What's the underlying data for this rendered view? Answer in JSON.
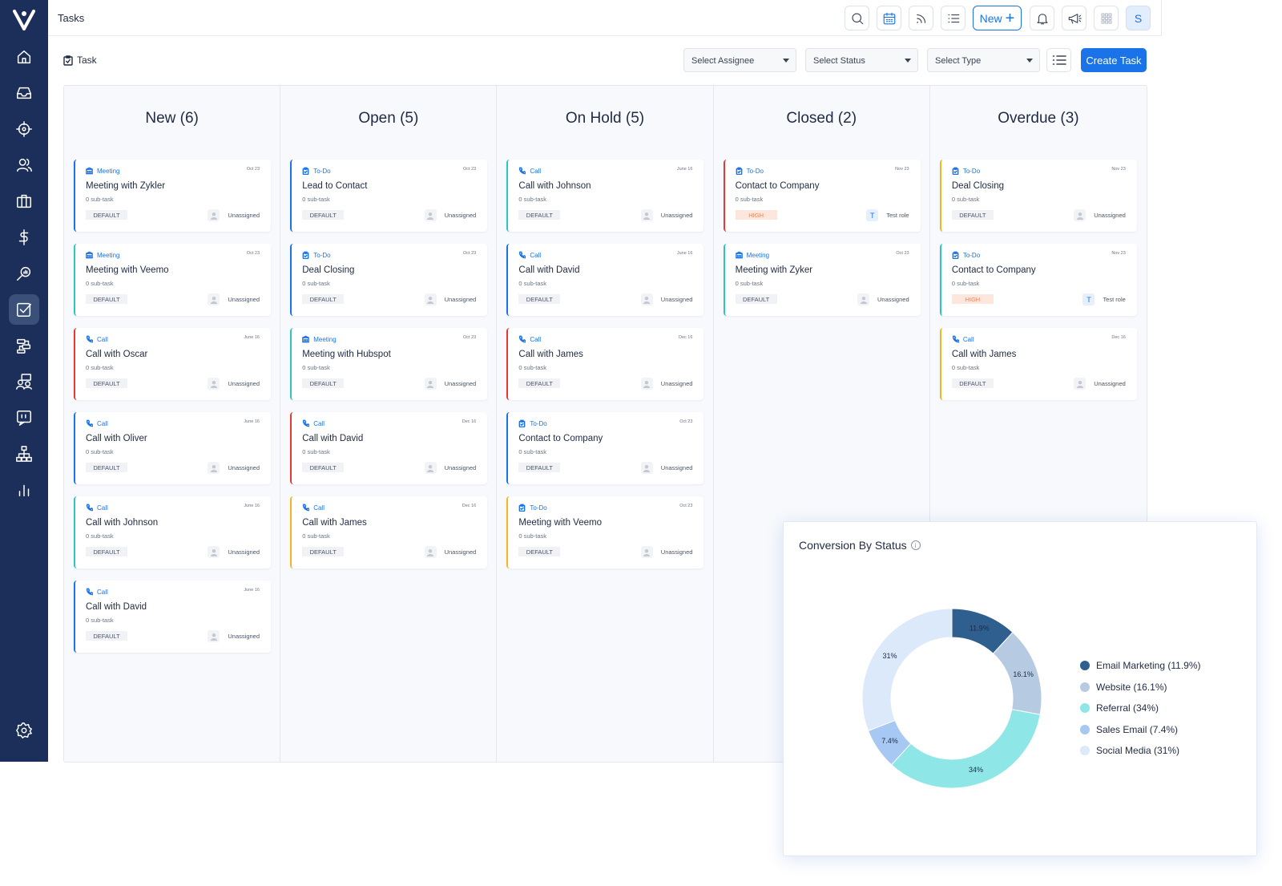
{
  "topbar": {
    "title": "Tasks",
    "new_label": "New",
    "avatar_initial": "S"
  },
  "filters": {
    "task_label": "Task",
    "assignee": "Select Assignee",
    "status": "Select Status",
    "type": "Select Type",
    "create_label": "Create Task"
  },
  "columns": [
    {
      "title": "New (6)",
      "cards": [
        {
          "type": "Meeting",
          "date": "Oct 23",
          "name": "Meeting with Zykler",
          "sub": "0 sub-task",
          "tag": "DEFAULT",
          "assignee": "Unassigned",
          "color": "#1a73e8"
        },
        {
          "type": "Meeting",
          "date": "Oct 23",
          "name": "Meeting with Veemo",
          "sub": "0 sub-task",
          "tag": "DEFAULT",
          "assignee": "Unassigned",
          "color": "#2ec4c4"
        },
        {
          "type": "Call",
          "date": "June 16",
          "name": "Call with Oscar",
          "sub": "0 sub-task",
          "tag": "DEFAULT",
          "assignee": "Unassigned",
          "color": "#e53935"
        },
        {
          "type": "Call",
          "date": "June 16",
          "name": "Call with Oliver",
          "sub": "0 sub-task",
          "tag": "DEFAULT",
          "assignee": "Unassigned",
          "color": "#1a73e8"
        },
        {
          "type": "Call",
          "date": "June 16",
          "name": "Call with Johnson",
          "sub": "0 sub-task",
          "tag": "DEFAULT",
          "assignee": "Unassigned",
          "color": "#2ec4c4"
        },
        {
          "type": "Call",
          "date": "June 16",
          "name": "Call with David",
          "sub": "0 sub-task",
          "tag": "DEFAULT",
          "assignee": "Unassigned",
          "color": "#1a73e8"
        }
      ]
    },
    {
      "title": "Open (5)",
      "cards": [
        {
          "type": "To-Do",
          "date": "Oct 23",
          "name": "Lead to Contact",
          "sub": "0 sub-task",
          "tag": "DEFAULT",
          "assignee": "Unassigned",
          "color": "#1a73e8"
        },
        {
          "type": "To-Do",
          "date": "Oct 23",
          "name": "Deal Closing",
          "sub": "0 sub-task",
          "tag": "DEFAULT",
          "assignee": "Unassigned",
          "color": "#1a73e8"
        },
        {
          "type": "Meeting",
          "date": "Oct 23",
          "name": "Meeting with Hubspot",
          "sub": "0 sub-task",
          "tag": "DEFAULT",
          "assignee": "Unassigned",
          "color": "#2ec4c4"
        },
        {
          "type": "Call",
          "date": "Dec 16",
          "name": "Call with David",
          "sub": "0 sub-task",
          "tag": "DEFAULT",
          "assignee": "Unassigned",
          "color": "#e53935"
        },
        {
          "type": "Call",
          "date": "Dec 16",
          "name": "Call with James",
          "sub": "0 sub-task",
          "tag": "DEFAULT",
          "assignee": "Unassigned",
          "color": "#f2b524"
        }
      ]
    },
    {
      "title": "On Hold (5)",
      "cards": [
        {
          "type": "Call",
          "date": "June 16",
          "name": "Call with Johnson",
          "sub": "0 sub-task",
          "tag": "DEFAULT",
          "assignee": "Unassigned",
          "color": "#2ec4c4"
        },
        {
          "type": "Call",
          "date": "June 16",
          "name": "Call with David",
          "sub": "0 sub-task",
          "tag": "DEFAULT",
          "assignee": "Unassigned",
          "color": "#1a73e8"
        },
        {
          "type": "Call",
          "date": "Dec 16",
          "name": "Call with James",
          "sub": "0 sub-task",
          "tag": "DEFAULT",
          "assignee": "Unassigned",
          "color": "#e53935"
        },
        {
          "type": "To-Do",
          "date": "Oct 23",
          "name": "Contact to Company",
          "sub": "0 sub-task",
          "tag": "DEFAULT",
          "assignee": "Unassigned",
          "color": "#1a73e8"
        },
        {
          "type": "To-Do",
          "date": "Oct 23",
          "name": "Meeting with Veemo",
          "sub": "0 sub-task",
          "tag": "DEFAULT",
          "assignee": "Unassigned",
          "color": "#f2b524"
        }
      ]
    },
    {
      "title": "Closed (2)",
      "cards": [
        {
          "type": "To-Do",
          "date": "Nov 23",
          "name": "Contact to Company",
          "sub": "0 sub-task",
          "tag": "HIGH",
          "assignee": "Test role",
          "avatar": "T",
          "color": "#e53935"
        },
        {
          "type": "Meeting",
          "date": "Oct 23",
          "name": "Meeting with Zyker",
          "sub": "0 sub-task",
          "tag": "DEFAULT",
          "assignee": "Unassigned",
          "color": "#2ec4c4"
        }
      ]
    },
    {
      "title": "Overdue (3)",
      "cards": [
        {
          "type": "To-Do",
          "date": "Nov 23",
          "name": "Deal Closing",
          "sub": "0 sub-task",
          "tag": "DEFAULT",
          "assignee": "Unassigned",
          "color": "#f2b524"
        },
        {
          "type": "To-Do",
          "date": "Nov 23",
          "name": "Contact to Company",
          "sub": "0 sub-task",
          "tag": "HIGH",
          "assignee": "Test role",
          "avatar": "T",
          "color": "#2ec4c4"
        },
        {
          "type": "Call",
          "date": "Dec 16",
          "name": "Call with James",
          "sub": "0 sub-task",
          "tag": "DEFAULT",
          "assignee": "Unassigned",
          "color": "#f2b524"
        }
      ]
    }
  ],
  "chart": {
    "title": "Conversion By Status"
  },
  "chart_data": {
    "type": "pie",
    "donut": true,
    "title": "Conversion By Status",
    "legend_position": "right",
    "slices": [
      {
        "label": "Email Marketing (11.9%)",
        "value": 11.9,
        "display": "11.9%",
        "color": "#2f5f8f"
      },
      {
        "label": "Website (16.1%)",
        "value": 16.1,
        "display": "16.1%",
        "color": "#b6cbe2"
      },
      {
        "label": "Referral (34%)",
        "value": 34,
        "display": "34%",
        "color": "#8ee6e6"
      },
      {
        "label": "Sales Email (7.4%)",
        "value": 7.4,
        "display": "7.4%",
        "color": "#a8c8f4"
      },
      {
        "label": "Social Media (31%)",
        "value": 31,
        "display": "31%",
        "color": "#dce9fb"
      }
    ]
  }
}
